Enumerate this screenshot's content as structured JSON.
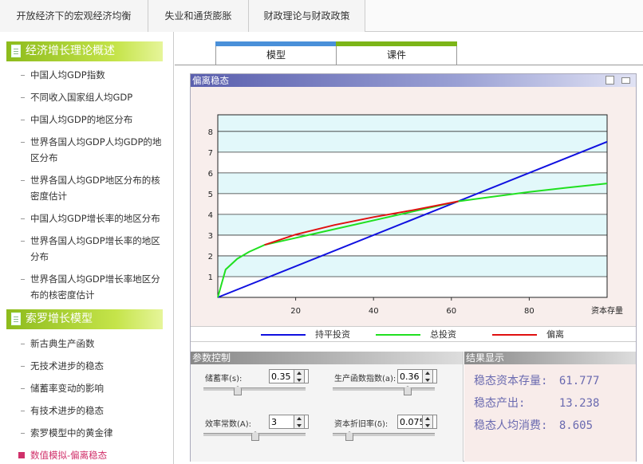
{
  "topnav": {
    "tabs": [
      "开放经济下的宏观经济均衡",
      "失业和通货膨胀",
      "财政理论与财政政策"
    ]
  },
  "sidebar": {
    "sections": [
      {
        "title": "经济增长理论概述",
        "items": [
          "中国人均GDP指数",
          "不同收入国家组人均GDP",
          "中国人均GDP的地区分布",
          "世界各国人均GDP人均GDP的地区分布",
          "世界各国人均GDP地区分布的核密度估计",
          "中国人均GDP增长率的地区分布",
          "世界各国人均GDP增长率的地区分布",
          "世界各国人均GDP增长率地区分布的核密度估计"
        ]
      },
      {
        "title": "索罗增长模型",
        "items": [
          "新古典生产函数",
          "无技术进步的稳态",
          "储蓄率变动的影响",
          "有技术进步的稳态",
          "索罗模型中的黄金律",
          "数值模拟-偏离稳态"
        ]
      }
    ],
    "active_item": "数值模拟-偏离稳态"
  },
  "main": {
    "tabs": [
      {
        "label": "模型",
        "color": "#4a90d9"
      },
      {
        "label": "课件",
        "color": "#7cb518"
      }
    ],
    "panel_title": "偏离稳态",
    "controls_title": "参数控制",
    "results_title": "结果显示",
    "params": [
      {
        "label": "储蓄率(s):",
        "value": "0.35",
        "level": 0.35
      },
      {
        "label": "生产函数指数(a):",
        "value": "0.36",
        "level": 0.36
      },
      {
        "label": "效率常数(A):",
        "value": "3",
        "level": 0.5
      },
      {
        "label": "资本折旧率(δ):",
        "value": "0.075",
        "level": 0.075
      }
    ],
    "results": [
      {
        "label": "稳态资本存量:",
        "value": "61.777"
      },
      {
        "label": "稳态产出:",
        "value": "13.238"
      },
      {
        "label": "稳态人均消费:",
        "value": "8.605"
      }
    ]
  },
  "chart_data": {
    "type": "line",
    "xlabel": "资本存量",
    "xticks": [
      20,
      40,
      60,
      80
    ],
    "yticks": [
      1,
      2,
      3,
      4,
      5,
      6,
      7,
      8
    ],
    "xlim": [
      0,
      100
    ],
    "ylim": [
      0,
      8.8
    ],
    "series": [
      {
        "name": "持平投资",
        "color": "#1010e0",
        "x": [
          0,
          100
        ],
        "y": [
          0,
          7.5
        ]
      },
      {
        "name": "总投资",
        "color": "#20e020",
        "x": [
          0,
          2,
          5,
          8,
          12,
          61.8,
          70,
          80,
          90,
          100
        ],
        "y": [
          0,
          1.34,
          1.86,
          2.19,
          2.53,
          4.63,
          4.84,
          5.08,
          5.29,
          5.49
        ]
      },
      {
        "name": "偏离",
        "color": "#e01010",
        "x": [
          12,
          20,
          30,
          40,
          50,
          61.8
        ],
        "y": [
          2.53,
          3.03,
          3.49,
          3.87,
          4.2,
          4.63
        ]
      }
    ],
    "grid": true,
    "legend_position": "bottom"
  }
}
